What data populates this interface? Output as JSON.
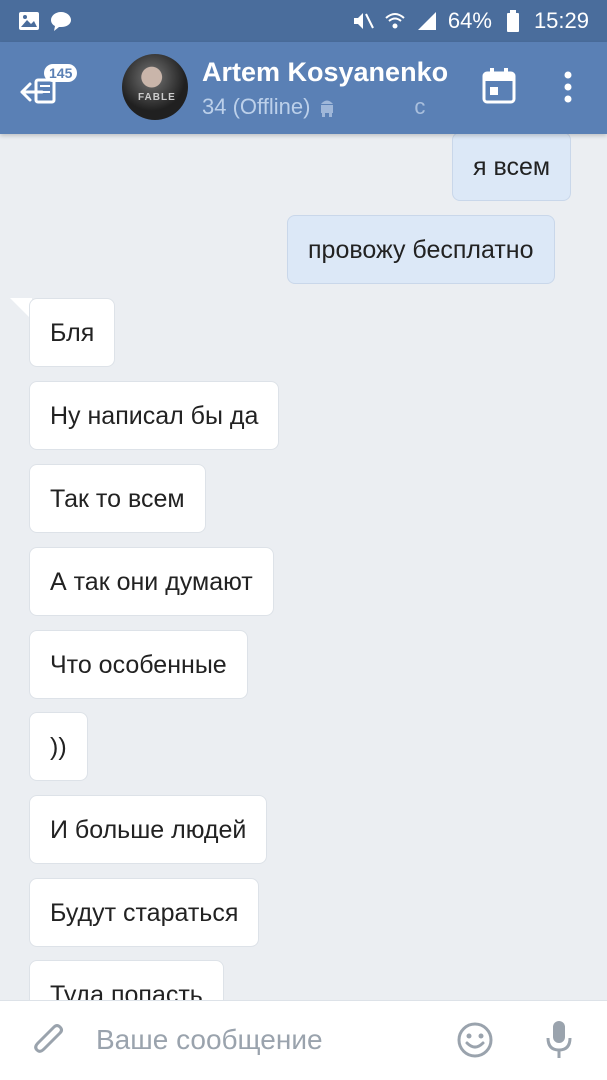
{
  "status_bar": {
    "battery": "64%",
    "time": "15:29"
  },
  "header": {
    "unread_count": "145",
    "contact_name": "Artem Kosyanenko",
    "contact_status": "34 (Offline)",
    "status_extra": "c",
    "avatar_text": "FABLE"
  },
  "messages": [
    {
      "text": "я всем",
      "direction": "out"
    },
    {
      "text": "провожу бесплатно",
      "direction": "out"
    },
    {
      "text": "Бля",
      "direction": "in"
    },
    {
      "text": "Ну написал бы да",
      "direction": "in"
    },
    {
      "text": "Так то всем",
      "direction": "in"
    },
    {
      "text": "А так они думают",
      "direction": "in"
    },
    {
      "text": "Что особенные",
      "direction": "in"
    },
    {
      "text": "))",
      "direction": "in"
    },
    {
      "text": "И больше людей",
      "direction": "in"
    },
    {
      "text": "Будут стараться",
      "direction": "in"
    },
    {
      "text": "Туда попасть",
      "direction": "in"
    }
  ],
  "composer": {
    "placeholder": "Ваше сообщение"
  },
  "colors": {
    "statusbar": "#4a6d9c",
    "appbar": "#5a80b5",
    "chat_background": "#ebeef2",
    "outgoing_bubble": "#dce8f7",
    "incoming_bubble": "#ffffff"
  }
}
